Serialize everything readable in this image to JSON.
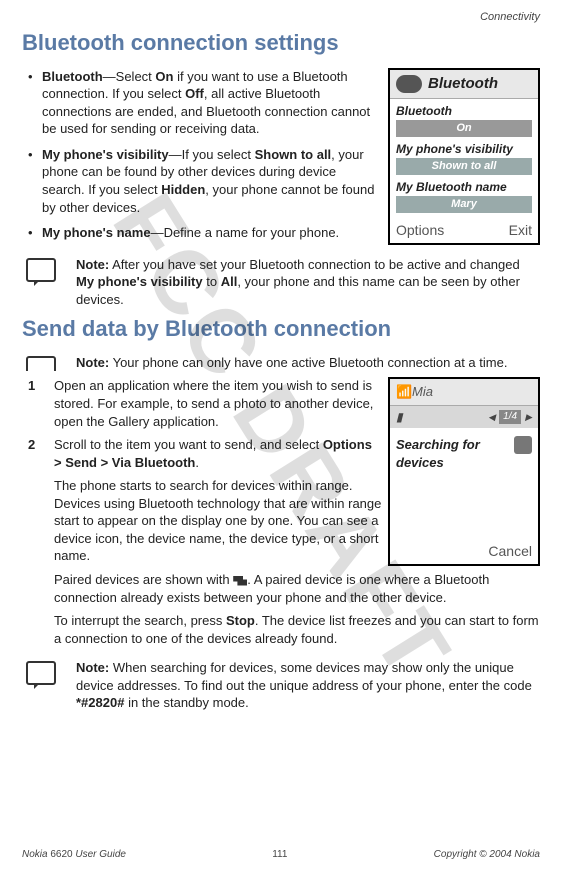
{
  "header": {
    "section": "Connectivity"
  },
  "watermark": "FCC DRAFT",
  "sections": {
    "h1": "Bluetooth connection settings",
    "h2": "Send data by Bluetooth connection"
  },
  "bullets": {
    "b1_lead": "Bluetooth",
    "b1_rest_a": "—Select ",
    "b1_on": "On",
    "b1_rest_b": " if you want to use a Bluetooth connection. If you select ",
    "b1_off": "Off",
    "b1_rest_c": ", all active Bluetooth connections are ended, and Bluetooth connection cannot be used for sending or receiving data.",
    "b2_lead": "My phone's visibility",
    "b2_rest_a": "—If you select ",
    "b2_shown": "Shown to all",
    "b2_rest_b": ", your phone can be found by other devices during device search. If you select ",
    "b2_hidden": "Hidden",
    "b2_rest_c": ", your phone cannot be found by other devices.",
    "b3_lead": "My phone's name",
    "b3_rest": "—Define a name for your phone."
  },
  "notes": {
    "n1_lead": "Note:",
    "n1_rest_a": " After you have set your Bluetooth connection to be active and changed ",
    "n1_bold": "My phone's visibility",
    "n1_rest_b": " to ",
    "n1_bold2": "All",
    "n1_rest_c": ", your phone and this name can be seen by other devices.",
    "n2_lead": "Note:",
    "n2_rest": " Your phone can only have one active Bluetooth connection at a time.",
    "n3_lead": "Note:",
    "n3_rest_a": " When searching for devices, some devices may show only the unique device addresses. To find out the unique address of your phone, enter the code ",
    "n3_code": "*#2820#",
    "n3_rest_b": " in the standby mode."
  },
  "steps": {
    "s1_num": "1",
    "s1": "Open an application where the item you wish to send is stored. For example, to send a photo to another device, open the Gallery application.",
    "s2_num": "2",
    "s2_a": "Scroll to the item you want to send, and select ",
    "s2_b": "Options > Send > Via Bluetooth",
    "s2_c": "."
  },
  "paras": {
    "p1": "The phone starts to search for devices within range. Devices using Bluetooth technology that are within range start to appear on the display one by one. You can see a device icon, the device name, the device type, or a short name.",
    "p2_a": "Paired devices are shown with ",
    "p2_b": ". A paired device is one where a Bluetooth connection already exists between your phone and the other device.",
    "p3_a": "To interrupt the search, press ",
    "p3_stop": "Stop",
    "p3_b": ". The device list freezes and you can start to form a connection to one of the devices already found."
  },
  "fig1": {
    "title": "Bluetooth",
    "row1_label": "Bluetooth",
    "row1_val": "On",
    "row2_label": "My phone's visibility",
    "row2_val": "Shown to all",
    "row3_label": "My Bluetooth name",
    "row3_val": "Mary",
    "lsoft": "Options",
    "rsoft": "Exit"
  },
  "fig2": {
    "title": "Mia",
    "counter": "1/4",
    "body_a": "Searching for",
    "body_b": "devices",
    "rsoft": "Cancel"
  },
  "footer": {
    "left_a": "Nokia ",
    "left_model": "6620",
    "left_b": " User Guide",
    "page": "111",
    "right": "Copyright © 2004 Nokia"
  }
}
